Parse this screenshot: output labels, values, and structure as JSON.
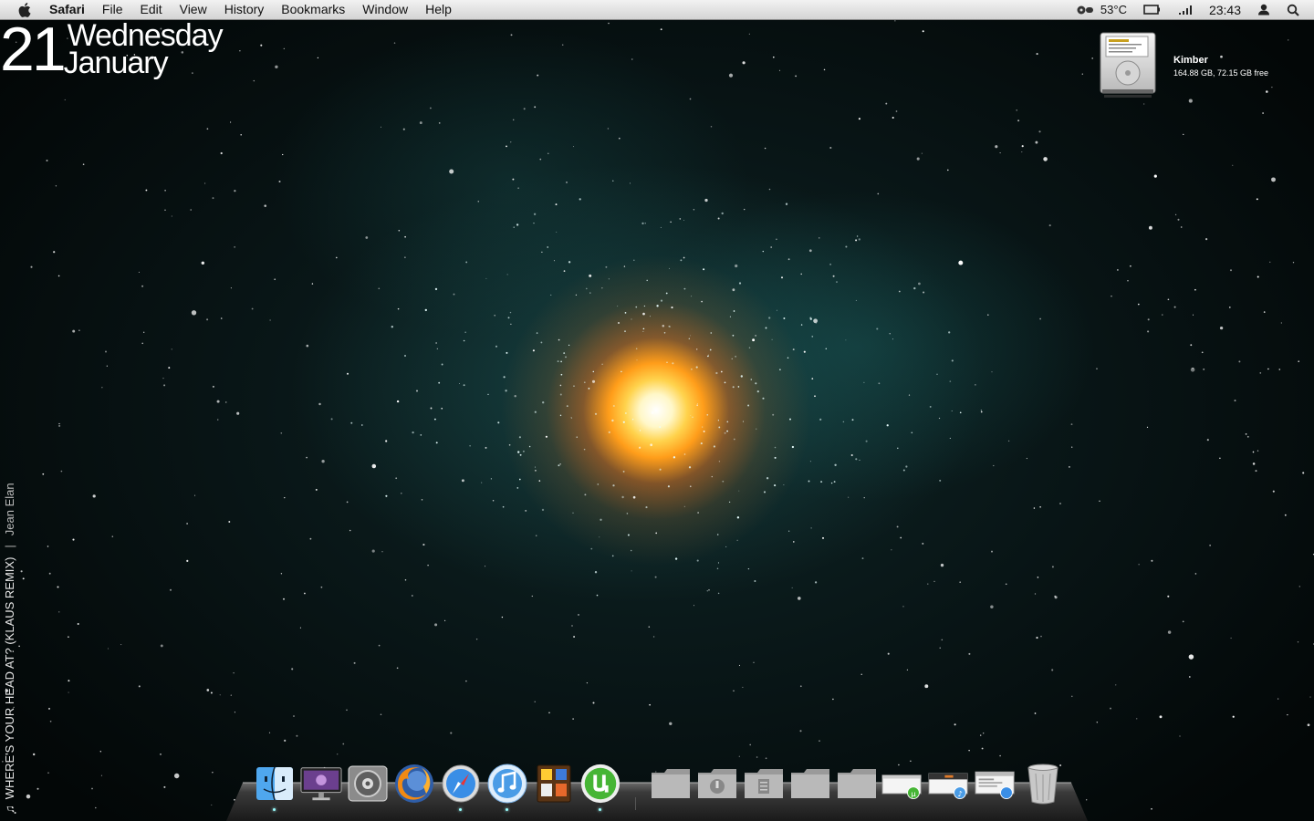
{
  "menubar": {
    "app_name": "Safari",
    "items": [
      "File",
      "Edit",
      "View",
      "History",
      "Bookmarks",
      "Window",
      "Help"
    ],
    "temperature": "53°C",
    "clock": "23:43"
  },
  "date_widget": {
    "day": "21",
    "weekday": "Wednesday",
    "month": "January"
  },
  "disk": {
    "name": "Kimber",
    "info": "164.88 GB, 72.15 GB free"
  },
  "now_playing": {
    "title": "WHERE'S YOUR HEAD AT? (KLAUS REMIX)",
    "separator": "|",
    "artist": "Jean Elan"
  },
  "dock": {
    "apps": [
      {
        "icon": "finder-icon",
        "running": true
      },
      {
        "icon": "display-icon",
        "running": false
      },
      {
        "icon": "system-preferences-icon",
        "running": false
      },
      {
        "icon": "firefox-icon",
        "running": false
      },
      {
        "icon": "safari-icon",
        "running": true
      },
      {
        "icon": "itunes-icon",
        "running": true
      },
      {
        "icon": "dashboard-widgets-icon",
        "running": false
      },
      {
        "icon": "utorrent-icon",
        "running": true
      }
    ],
    "stacks": [
      {
        "icon": "folder-icon"
      },
      {
        "icon": "downloads-folder-icon"
      },
      {
        "icon": "documents-folder-icon"
      },
      {
        "icon": "folder-icon"
      },
      {
        "icon": "folder-icon"
      },
      {
        "icon": "minimized-utorrent-window-icon"
      },
      {
        "icon": "minimized-itunes-window-icon"
      },
      {
        "icon": "minimized-safari-window-icon"
      },
      {
        "icon": "trash-icon"
      }
    ]
  },
  "colors": {
    "menubar_bg": "#e6e6e6",
    "space_bg": "#081415",
    "core_glow": "#ffd34d",
    "nebula": "#1e5f5f"
  }
}
